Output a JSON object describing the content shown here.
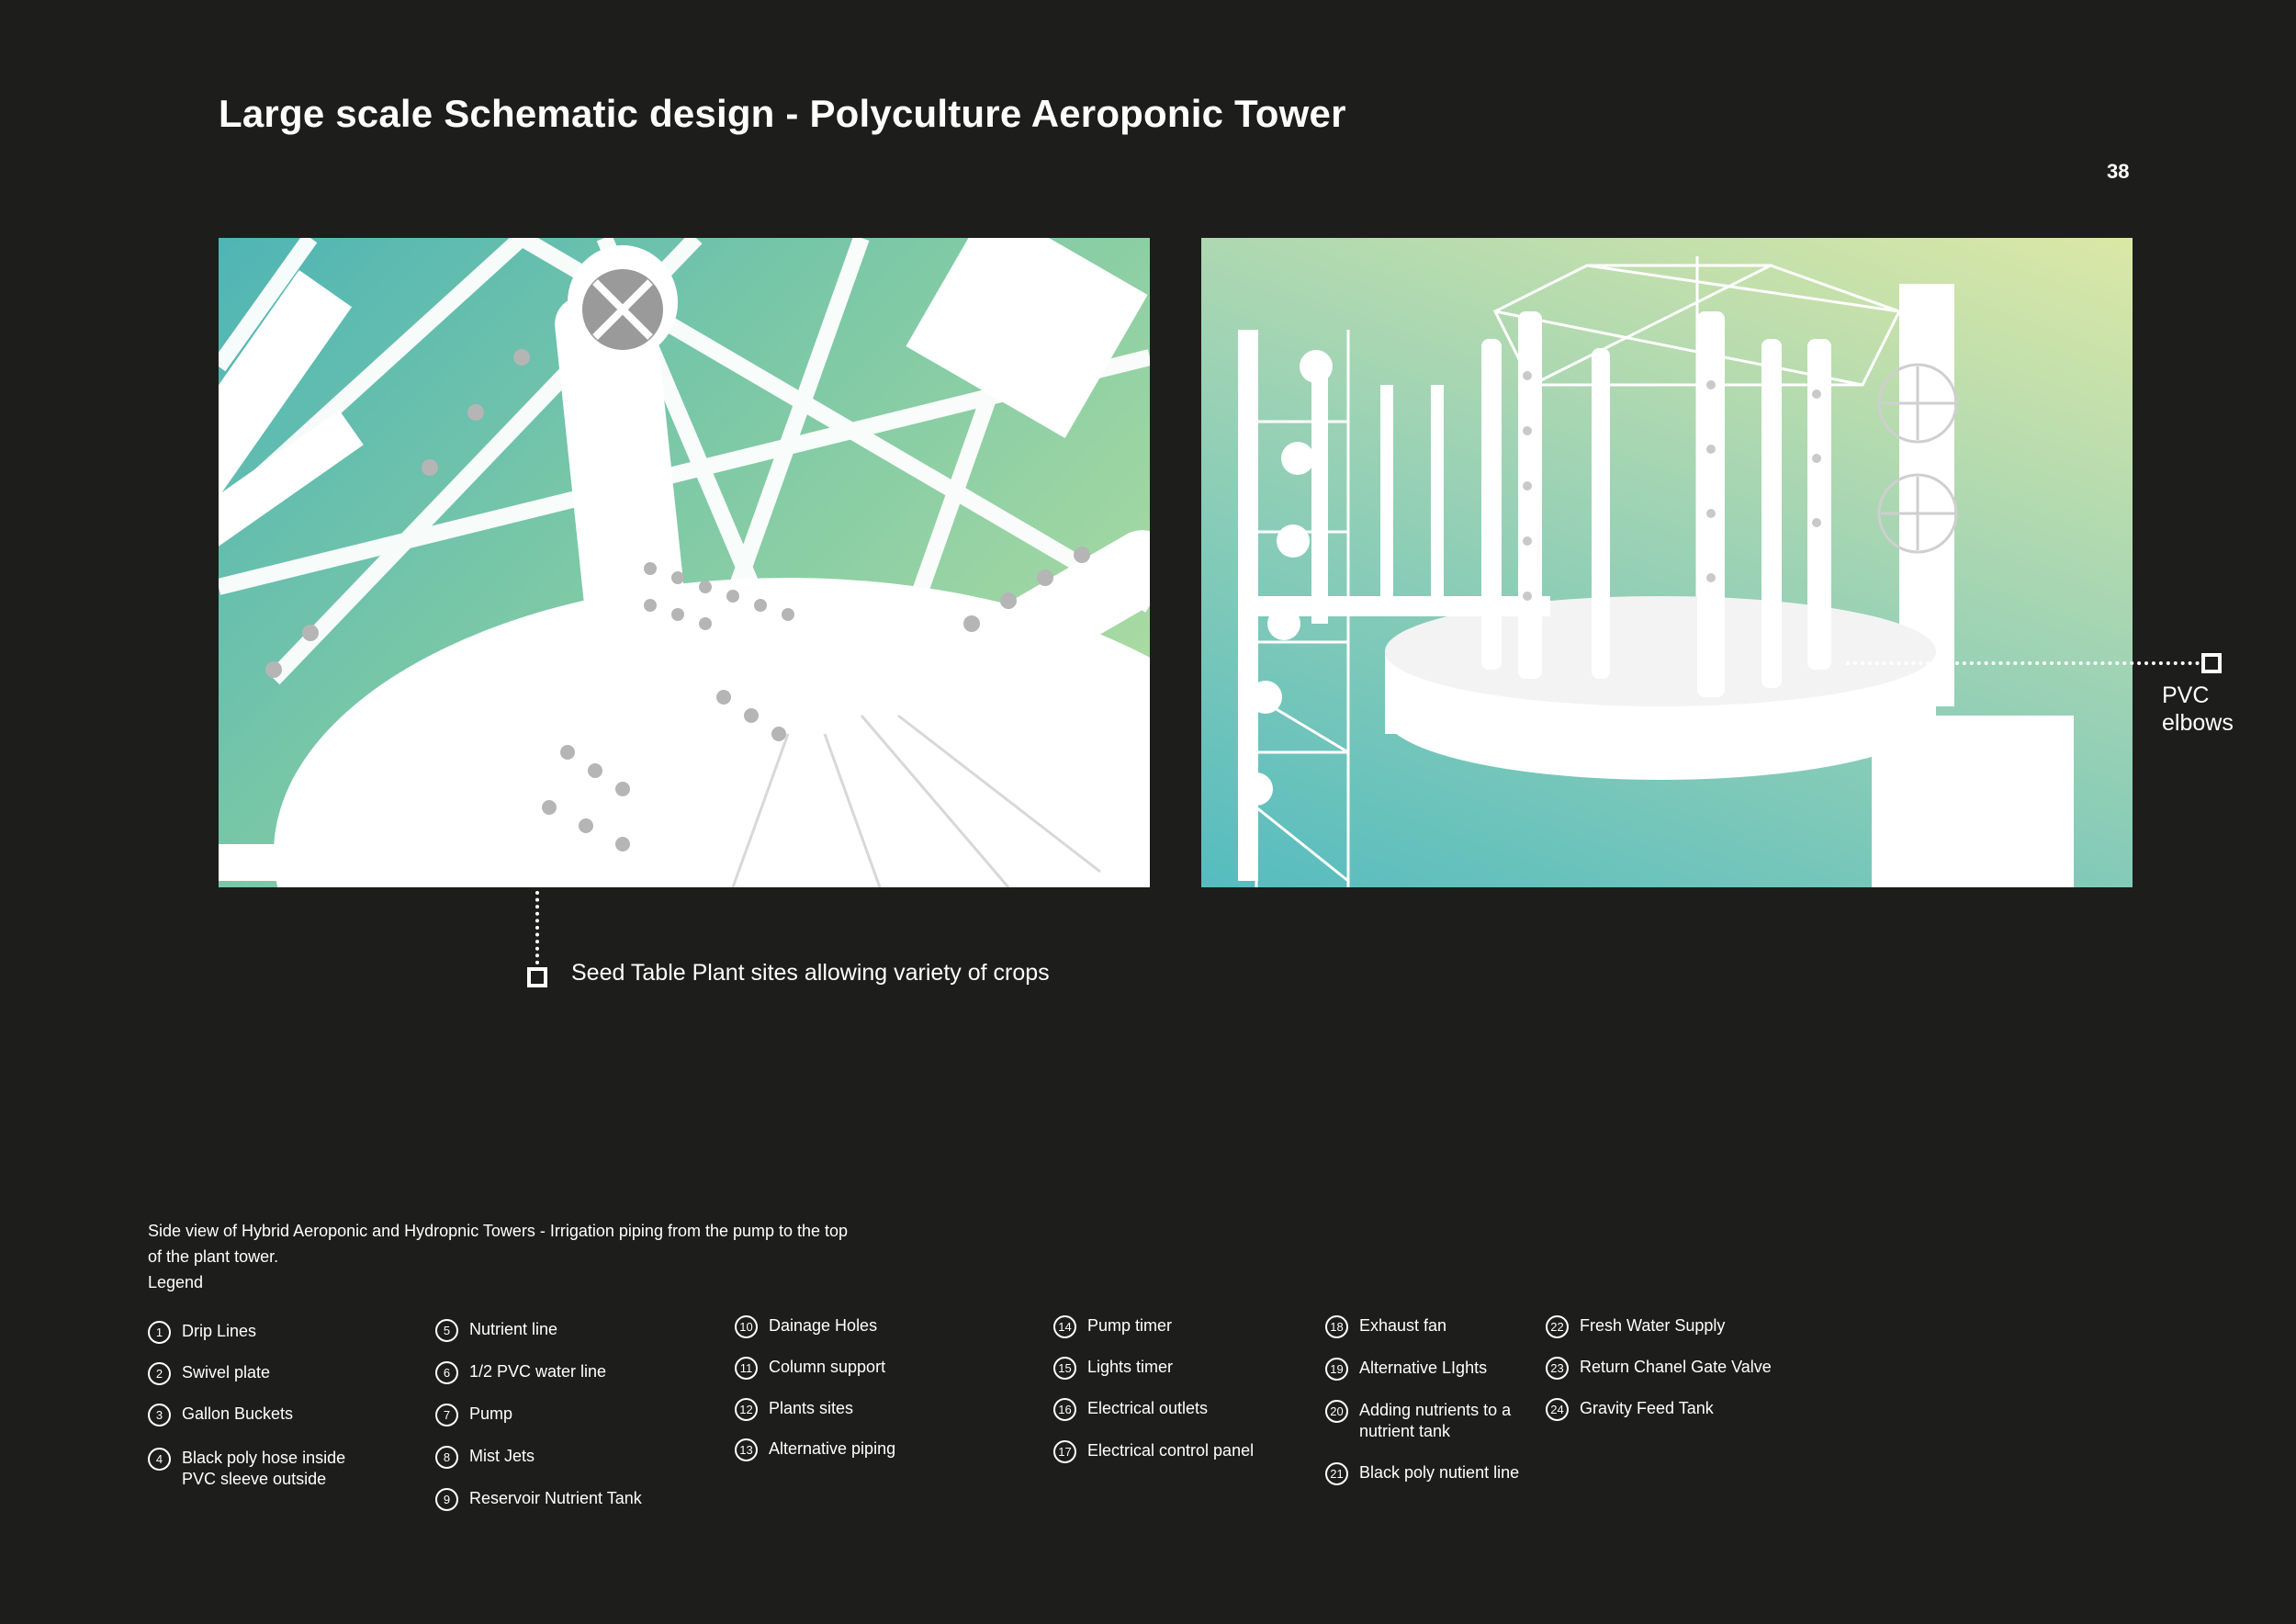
{
  "header": {
    "title": "Large scale Schematic design - Polyculture Aeroponic Tower",
    "page_number": "38"
  },
  "callouts": {
    "seed": "Seed Table Plant sites allowing variety of crops",
    "pvc": "PVC elbows"
  },
  "caption": {
    "line1": "Side view of Hybrid Aeroponic and Hydropnic Towers - Irrigation piping from the pump to the top",
    "line2": "of the plant tower.",
    "legend_heading": "Legend"
  },
  "legend": [
    {
      "num": "1",
      "label": "Drip Lines"
    },
    {
      "num": "2",
      "label": "Swivel plate"
    },
    {
      "num": "3",
      "label": "Gallon Buckets"
    },
    {
      "num": "4",
      "label": "Black poly hose inside\nPVC sleeve outside"
    },
    {
      "num": "5",
      "label": "Nutrient line"
    },
    {
      "num": "6",
      "label": "1/2 PVC water line"
    },
    {
      "num": "7",
      "label": "Pump"
    },
    {
      "num": "8",
      "label": "Mist Jets"
    },
    {
      "num": "9",
      "label": "Reservoir Nutrient Tank"
    },
    {
      "num": "10",
      "label": "Dainage Holes"
    },
    {
      "num": "11",
      "label": "Column support"
    },
    {
      "num": "12",
      "label": "Plants sites"
    },
    {
      "num": "13",
      "label": "Alternative piping"
    },
    {
      "num": "14",
      "label": "Pump timer"
    },
    {
      "num": "15",
      "label": "Lights timer"
    },
    {
      "num": "16",
      "label": "Electrical outlets"
    },
    {
      "num": "17",
      "label": "Electrical control panel"
    },
    {
      "num": "18",
      "label": "Exhaust fan"
    },
    {
      "num": "19",
      "label": "Alternative LIghts"
    },
    {
      "num": "20",
      "label": "Adding nutrients to a\nnutrient tank"
    },
    {
      "num": "21",
      "label": "Black poly nutient line"
    },
    {
      "num": "22",
      "label": "Fresh Water Supply"
    },
    {
      "num": "23",
      "label": "Return Chanel Gate Valve"
    },
    {
      "num": "24",
      "label": "Gravity Feed Tank"
    }
  ]
}
